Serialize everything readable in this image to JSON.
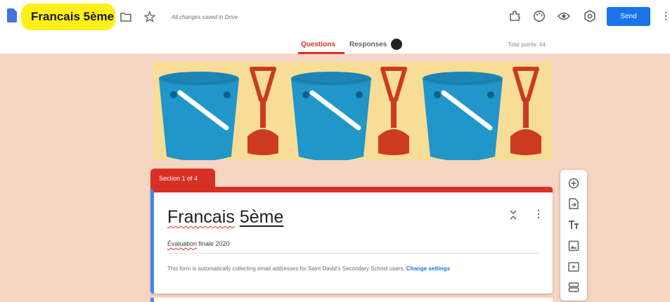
{
  "header": {
    "title": "Francais 5ème",
    "save_status": "All changes saved in Drive",
    "send_label": "Send",
    "more_label": "⋮",
    "icons": [
      "doc-icon",
      "folder-icon",
      "star-icon",
      "addon-icon",
      "palette-icon",
      "eye-icon",
      "settings-icon",
      "more-icon"
    ]
  },
  "tabs": {
    "questions_label": "Questions",
    "responses_label": "Responses",
    "total_points": "Total points: 44"
  },
  "section": {
    "label": "Section 1 of 4"
  },
  "card": {
    "title_word1": "Francais",
    "title_word2": "5ème",
    "desc_first": "Évaluation",
    "desc_rest": " finale 2020",
    "notice": "This form is automatically collecting email addresses for Saint David's Secondary School users.",
    "change_link": "Change settings",
    "more_label": "⋮"
  },
  "toolbar": {
    "icons": [
      "add-question-icon",
      "import-questions-icon",
      "add-title-icon",
      "add-image-icon",
      "add-video-icon",
      "add-section-icon"
    ]
  },
  "colors": {
    "accent": "#d93025",
    "blue": "#1a73e8",
    "highlight": "#ffef1a",
    "page_bg": "#f7d5c3",
    "banner_bg": "#f8dd96",
    "bucket": "#2196c9",
    "shovel": "#cc3a22"
  }
}
